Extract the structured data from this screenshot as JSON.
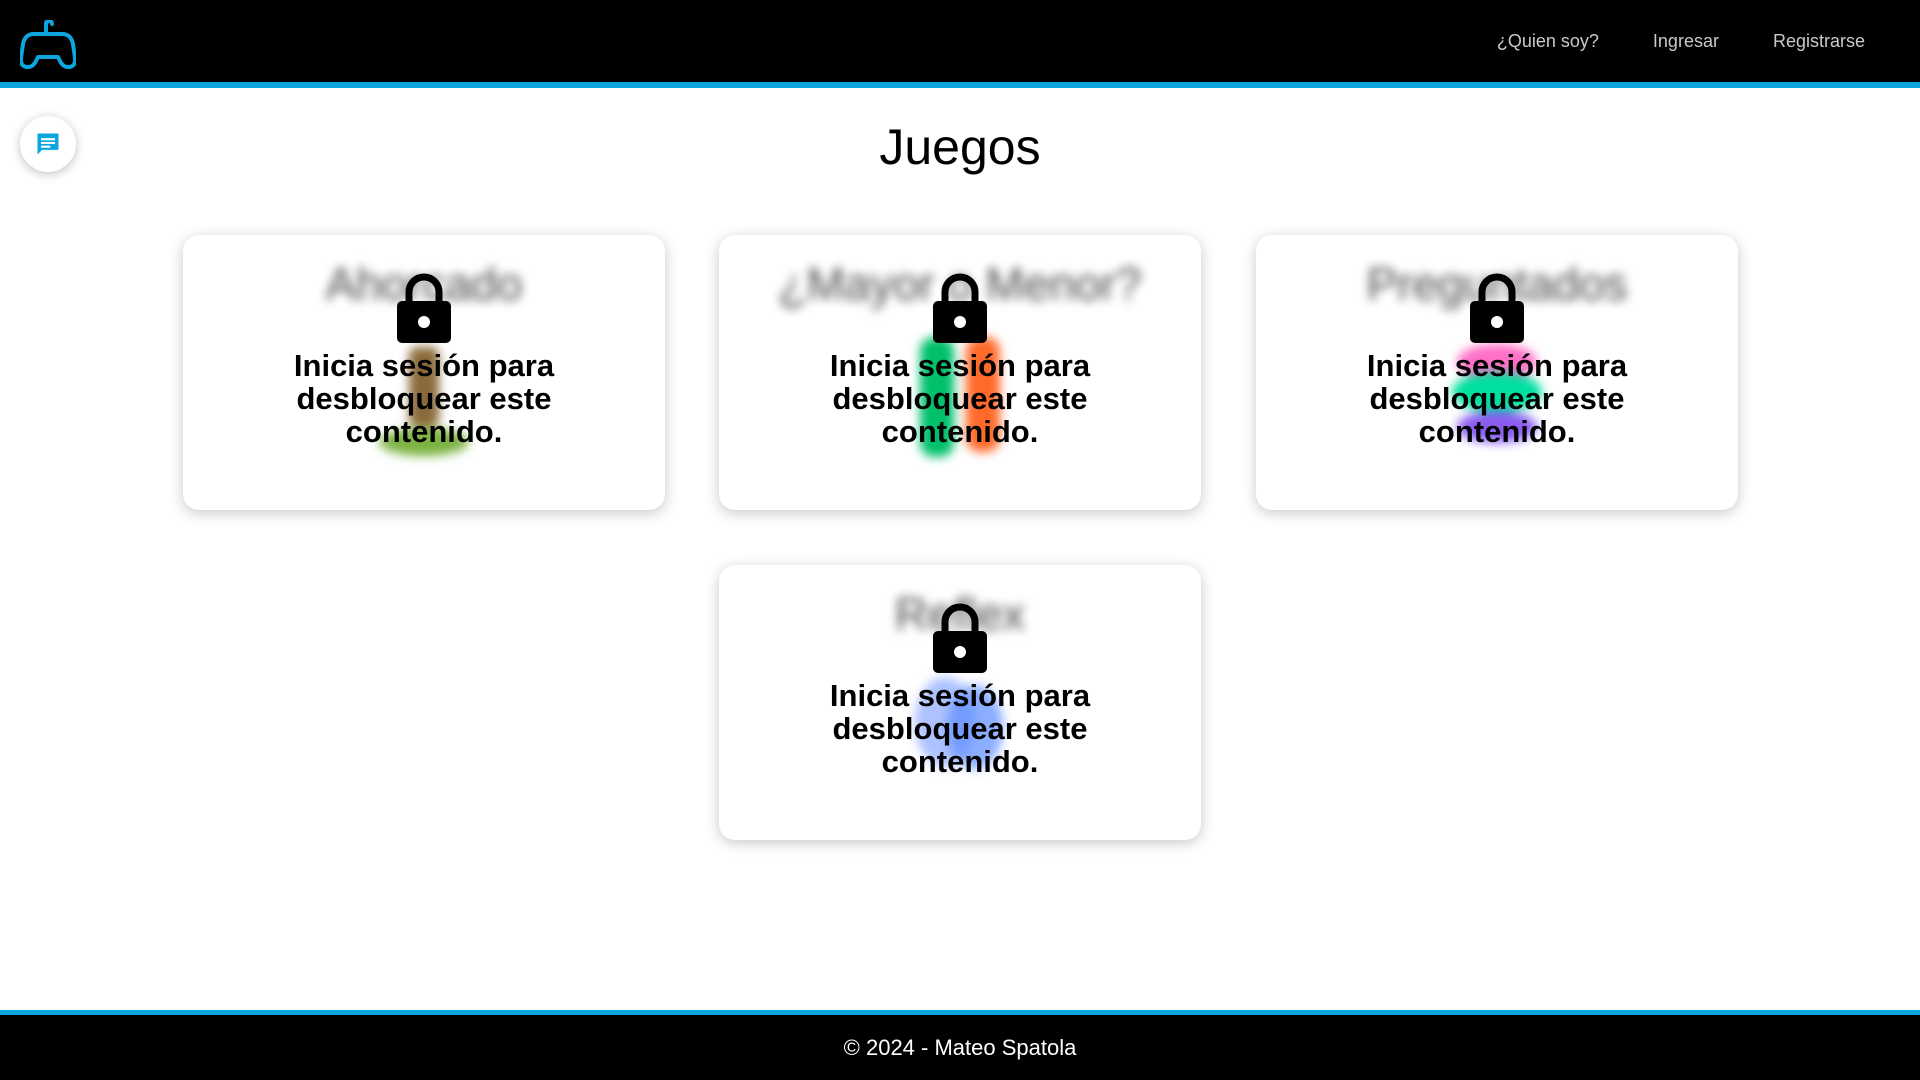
{
  "colors": {
    "accent": "#0ba5e0",
    "header_bg": "#000000",
    "nav_text": "#c9c9c9",
    "page_bg": "#ffffff"
  },
  "header": {
    "logo_icon": "gamepad-icon",
    "nav": [
      {
        "label": "¿Quien soy?"
      },
      {
        "label": "Ingresar"
      },
      {
        "label": "Registrarse"
      }
    ]
  },
  "chat": {
    "icon": "chat-bubble-icon"
  },
  "main": {
    "title": "Juegos",
    "cards": [
      {
        "game_title": "Ahorcado",
        "art_colors": [
          "#8a6a3a",
          "#7cb342"
        ],
        "lock_icon": "lock-icon",
        "message": "Inicia sesión para desbloquear este contenido."
      },
      {
        "game_title": "¿Mayor o Menor?",
        "art_colors": [
          "#00c06a",
          "#ff6a2a"
        ],
        "lock_icon": "lock-icon",
        "message": "Inicia sesión para desbloquear este contenido."
      },
      {
        "game_title": "Preguntados",
        "art_colors": [
          "#ff6fc8",
          "#00e0a0",
          "#8a5cf0"
        ],
        "lock_icon": "lock-icon",
        "message": "Inicia sesión para desbloquear este contenido."
      },
      {
        "game_title": "Reflex",
        "art_colors": [
          "#5b8cff",
          "#8aa8ff"
        ],
        "lock_icon": "lock-icon",
        "message": "Inicia sesión para desbloquear este contenido."
      }
    ]
  },
  "footer": {
    "text": "© 2024 - Mateo Spatola"
  }
}
